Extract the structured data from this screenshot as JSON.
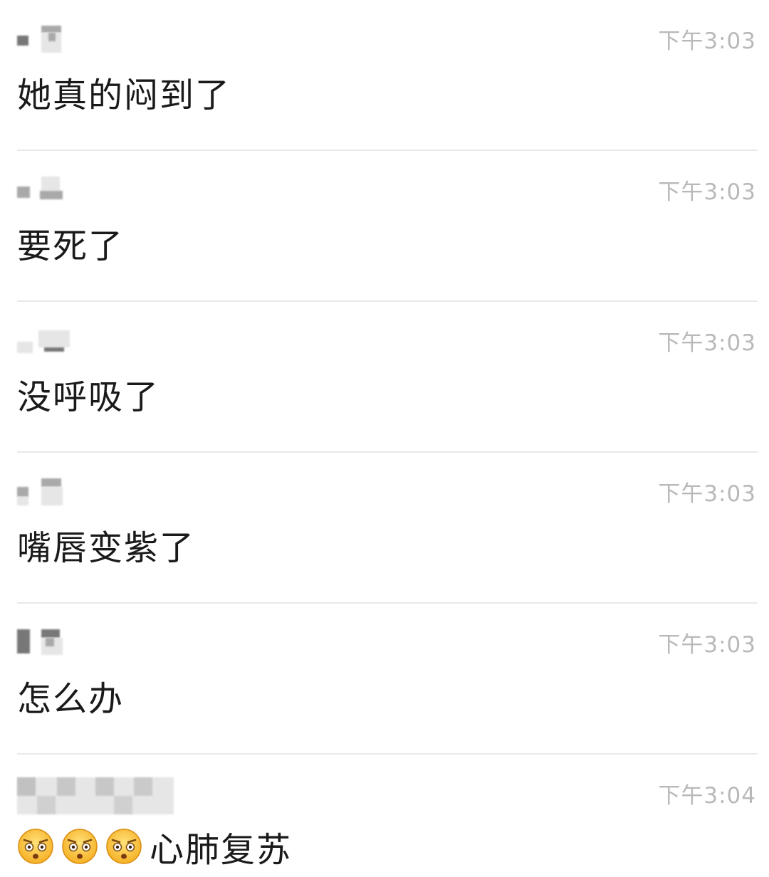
{
  "messages": [
    {
      "time": "下午3:03",
      "text": "她真的闷到了"
    },
    {
      "time": "下午3:03",
      "text": "要死了"
    },
    {
      "time": "下午3:03",
      "text": "没呼吸了"
    },
    {
      "time": "下午3:03",
      "text": "嘴唇变紫了"
    },
    {
      "time": "下午3:03",
      "text": "怎么办"
    },
    {
      "time": "下午3:04",
      "text": "心肺复苏",
      "emoji": "surprised-face-icon"
    }
  ]
}
